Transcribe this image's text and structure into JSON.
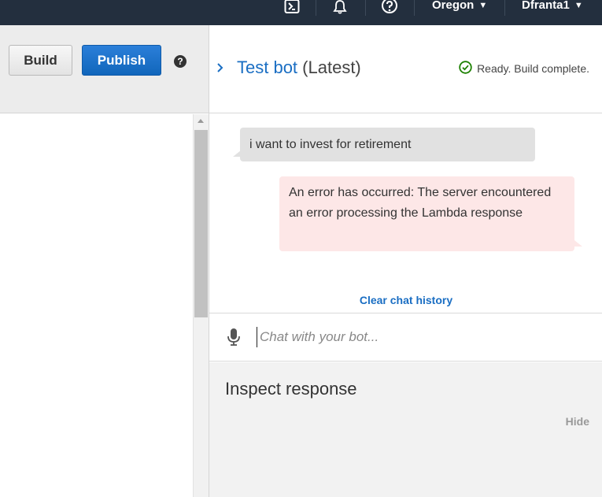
{
  "topbar": {
    "region": "Oregon",
    "user": "Dfranta1",
    "caret": "▼",
    "icons": [
      "terminal-icon",
      "bell-icon",
      "help-circle-icon"
    ]
  },
  "toolbar": {
    "build_label": "Build",
    "publish_label": "Publish",
    "help_glyph": "?"
  },
  "test_panel": {
    "title_link": "Test bot",
    "title_suffix": "(Latest)",
    "status": "Ready. Build complete.",
    "status_color": "#1d8102"
  },
  "chat": {
    "messages": [
      {
        "role": "user",
        "text": "i want to invest for retirement"
      },
      {
        "role": "bot",
        "text": "An error has occurred: The server encountered an error processing the Lambda response"
      }
    ],
    "clear_label": "Clear chat history",
    "input_placeholder": "Chat with your bot..."
  },
  "inspect": {
    "title": "Inspect response",
    "hide_label": "Hide"
  },
  "colors": {
    "nav_bg": "#232f3e",
    "link": "#1a6ec3",
    "publish_bg": "#1166bb",
    "error_bubble": "#fde7e7"
  }
}
